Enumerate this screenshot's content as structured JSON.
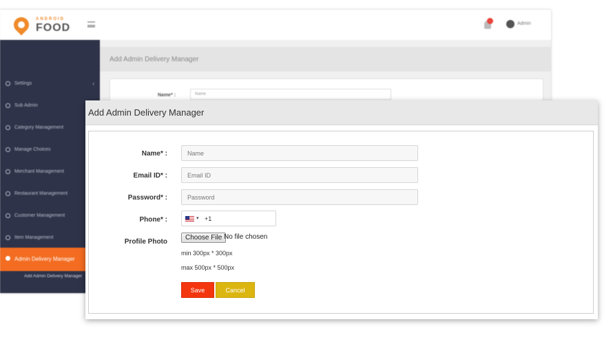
{
  "background": {
    "logo": {
      "small_text": "ANDROID",
      "brand": "FOOD"
    },
    "user_label": "Admin",
    "sidebar": {
      "items": [
        {
          "label": "Settings"
        },
        {
          "label": "Sub Admin"
        },
        {
          "label": "Category Management"
        },
        {
          "label": "Manage Choices"
        },
        {
          "label": "Merchant Management"
        },
        {
          "label": "Restaurant Management"
        },
        {
          "label": "Customer Management"
        },
        {
          "label": "Item Management"
        },
        {
          "label": "Admin Delivery Manager"
        }
      ],
      "sub_item": "Add Admin Delivery Manager"
    },
    "page_title": "Add Admin Delivery Manager",
    "name_label": "Name* :",
    "name_placeholder": "Name"
  },
  "modal": {
    "title": "Add Admin Delivery Manager",
    "fields": {
      "name": {
        "label": "Name* :",
        "placeholder": "Name"
      },
      "email": {
        "label": "Email ID* :",
        "placeholder": "Email ID"
      },
      "password": {
        "label": "Password* :",
        "placeholder": "Password"
      },
      "phone": {
        "label": "Phone* :",
        "dial_code": "+1",
        "caret": "▾"
      },
      "photo": {
        "label": "Profile Photo",
        "button": "Choose File",
        "status": "No file chosen",
        "min_hint": "min 300px * 300px",
        "max_hint": "max 500px * 500px"
      }
    },
    "buttons": {
      "save": "Save",
      "cancel": "Cancel"
    }
  },
  "colors": {
    "sidebar_bg": "#2e3349",
    "active_item": "#f36c21",
    "save": "#f4360f",
    "cancel": "#dbb611"
  }
}
